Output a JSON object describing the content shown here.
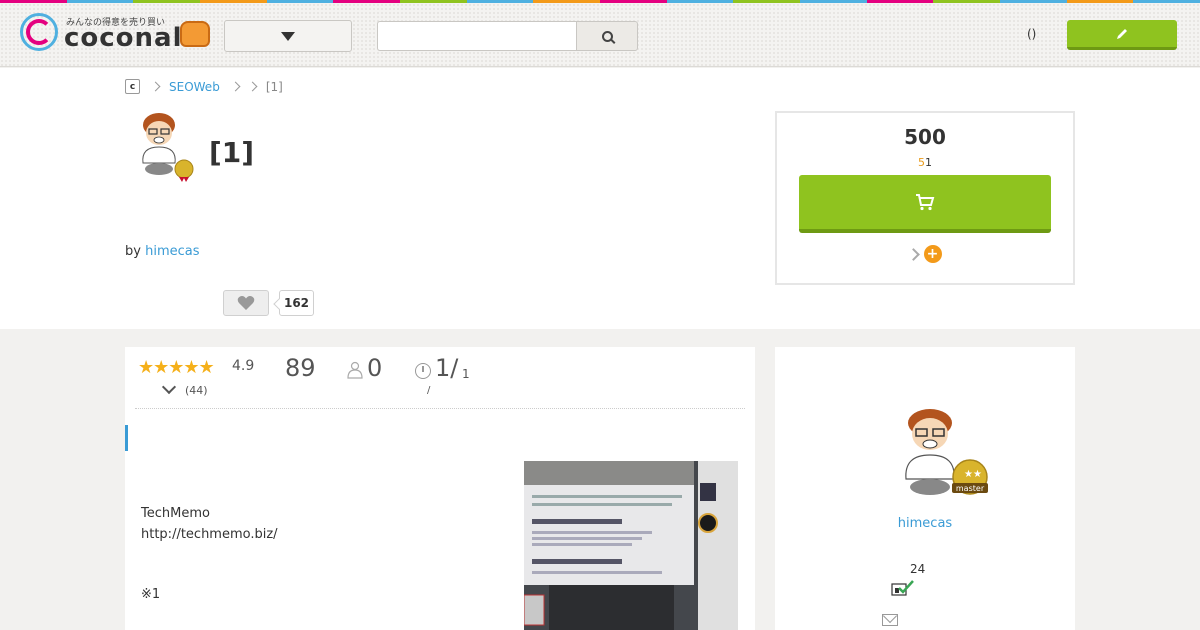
{
  "header": {
    "logo_tagline": "みんなの得意を売り買い",
    "logo_word": "coconala",
    "search": {
      "value": "",
      "placeholder": ""
    },
    "paren_text": "()",
    "post_button_icon": "pencil-icon"
  },
  "stripe_colors": [
    "#e4007f",
    "#4fb0e0",
    "#8fc31f",
    "#f39a1a",
    "#4fb0e0",
    "#e4007f",
    "#8fc31f",
    "#4fb0e0",
    "#f39a1a",
    "#e4007f",
    "#4fb0e0",
    "#8fc31f",
    "#4fb0e0",
    "#e4007f",
    "#8fc31f",
    "#4fb0e0",
    "#f39a1a",
    "#4fb0e0"
  ],
  "breadcrumb": {
    "home": "c",
    "items": [
      "SEOWeb",
      "",
      "[1]"
    ]
  },
  "service": {
    "title": "[1]",
    "by_label": "by",
    "seller": "himecas",
    "favorite_count": "162"
  },
  "purchase": {
    "price": "500",
    "sub_orange": "5",
    "sub_number": "1",
    "accent": "#8fc31f"
  },
  "stats": {
    "stars": "★★★★★",
    "rating": "4.9",
    "rating_count": "(44)",
    "sales": "89",
    "in_progress": "0",
    "days": "1",
    "days_sub": "1",
    "days_slash": "/",
    "days_prefix": "/"
  },
  "body": {
    "lines": "TechMemo\nhttp://techmemo.biz/",
    "note": "※1"
  },
  "seller_card": {
    "name": "himecas",
    "count": "24",
    "badge": "master"
  }
}
